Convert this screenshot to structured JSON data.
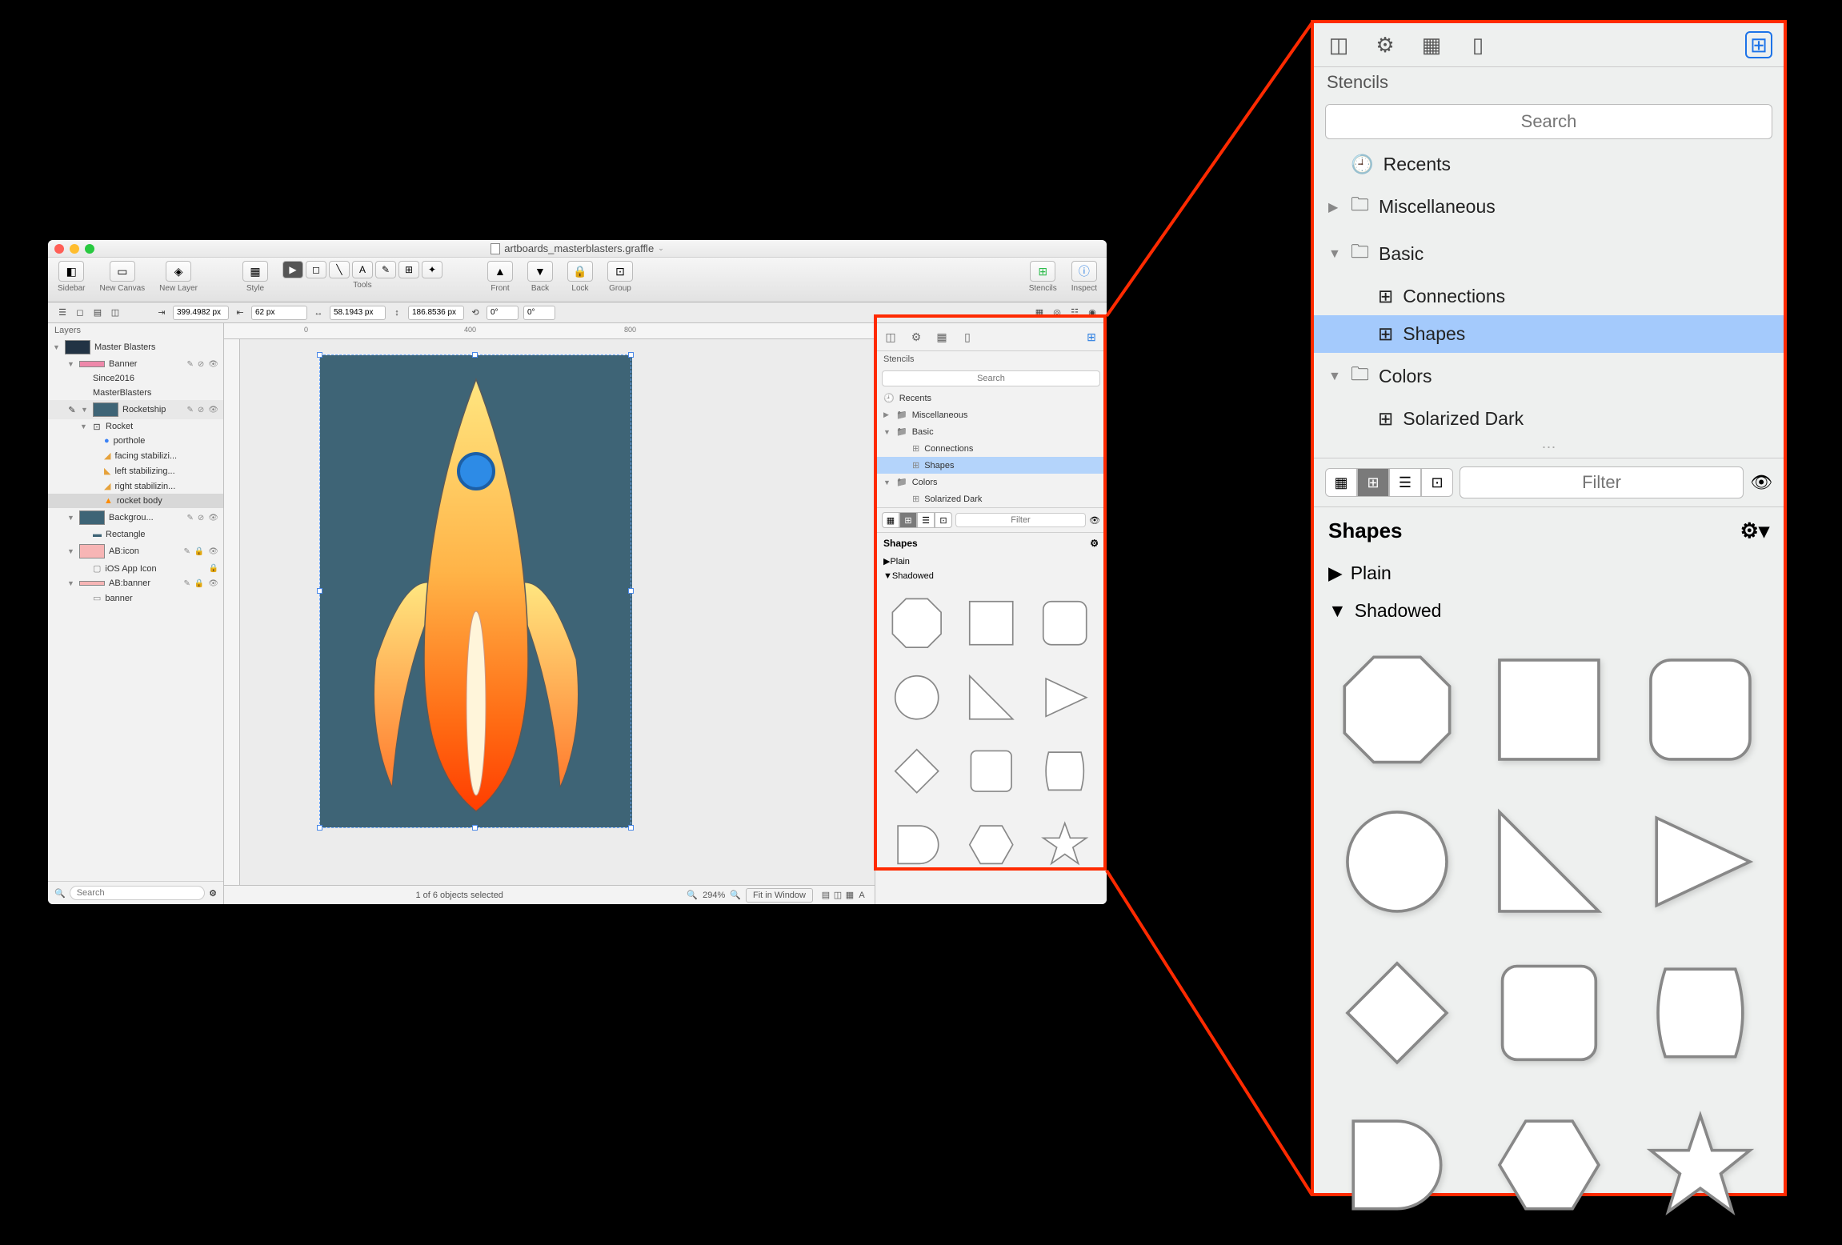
{
  "window": {
    "filename": "artboards_masterblasters.graffle",
    "traffic": {
      "close": "#ff5f57",
      "min": "#ffbd2e",
      "max": "#28c940"
    }
  },
  "toolbar": {
    "sidebar": "Sidebar",
    "newCanvas": "New Canvas",
    "newLayer": "New Layer",
    "style": "Style",
    "tools": "Tools",
    "front": "Front",
    "back": "Back",
    "lock": "Lock",
    "group": "Group",
    "stencils": "Stencils",
    "inspect": "Inspect"
  },
  "measure": {
    "x": "399.4982 px",
    "y": "62 px",
    "w": "58.1943 px",
    "h": "186.8536 px",
    "angle": "0°",
    "angle2": "0°"
  },
  "left": {
    "title": "Layers",
    "masterBlasters": "Master Blasters",
    "banner": "Banner",
    "since2016": "Since2016",
    "mb": "MasterBlasters",
    "rocketshipGroup": "Rocketship",
    "rocket": "Rocket",
    "porthole": "porthole",
    "facing": "facing stabilizi...",
    "leftStab": "left stabilizing...",
    "rightStab": "right stabilizin...",
    "rocketBody": "rocket body",
    "background": "Backgrou...",
    "rectangle": "Rectangle",
    "abIcon": "AB:icon",
    "iosIcon": "iOS App Icon",
    "abBanner": "AB:banner",
    "bannerItem": "banner",
    "searchPlaceholder": "Search",
    "lockIcon": "🔒",
    "eyeIcon": "👁"
  },
  "ruler": {
    "m0": "0",
    "m400": "400",
    "m800": "800"
  },
  "status": {
    "selection": "1 of 6 objects selected",
    "zoom": "294%",
    "fit": "Fit in Window"
  },
  "stencilSmall": {
    "header": "Stencils",
    "search": "Search",
    "recents": "Recents",
    "misc": "Miscellaneous",
    "basic": "Basic",
    "connections": "Connections",
    "shapes": "Shapes",
    "colors": "Colors",
    "solarized": "Solarized Dark",
    "filter": "Filter",
    "sectShapes": "Shapes",
    "plain": "Plain",
    "shadowed": "Shadowed"
  },
  "stencilZoom": {
    "header": "Stencils",
    "search": "Search",
    "recents": "Recents",
    "misc": "Miscellaneous",
    "basic": "Basic",
    "connections": "Connections",
    "shapes": "Shapes",
    "colors": "Colors",
    "solarized": "Solarized Dark",
    "filter": "Filter",
    "sectShapes": "Shapes",
    "plain": "Plain",
    "shadowed": "Shadowed"
  }
}
